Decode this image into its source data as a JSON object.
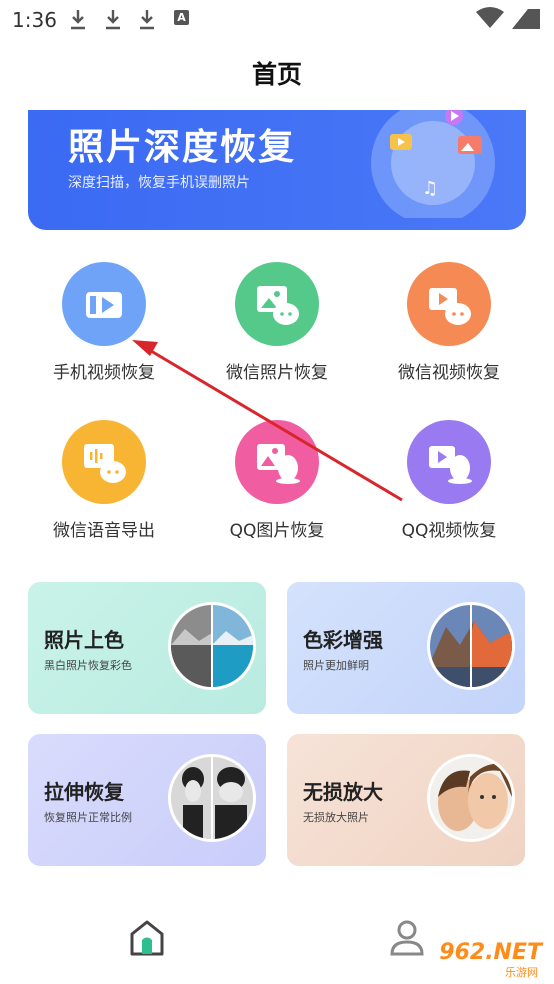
{
  "status_bar": {
    "time": "1:36",
    "icons": [
      "download-icon",
      "download-icon",
      "download-icon",
      "a-icon",
      "wifi-icon",
      "battery-icon"
    ],
    "a_label": "A"
  },
  "header": {
    "title": "首页"
  },
  "banner": {
    "title": "照片深度恢复",
    "subtitle": "深度扫描，恢复手机误删照片"
  },
  "features": [
    {
      "label": "手机视频恢复",
      "icon": "video-icon",
      "color": "#6fa3f7"
    },
    {
      "label": "微信照片恢复",
      "icon": "wechat-photo-icon",
      "color": "#55c98a"
    },
    {
      "label": "微信视频恢复",
      "icon": "wechat-video-icon",
      "color": "#f58a55"
    },
    {
      "label": "微信语音导出",
      "icon": "wechat-voice-icon",
      "color": "#f8b534"
    },
    {
      "label": "QQ图片恢复",
      "icon": "qq-photo-icon",
      "color": "#f05ea1"
    },
    {
      "label": "QQ视频恢复",
      "icon": "qq-video-icon",
      "color": "#9a7af0"
    }
  ],
  "cards": [
    {
      "title": "照片上色",
      "subtitle": "黑白照片恢复彩色",
      "bg": "#c5f0e6"
    },
    {
      "title": "色彩增强",
      "subtitle": "照片更加鲜明",
      "bg": "#cfdcfb"
    },
    {
      "title": "拉伸恢复",
      "subtitle": "恢复照片正常比例",
      "bg": "#d4d8fb"
    },
    {
      "title": "无损放大",
      "subtitle": "无损放大照片",
      "bg": "#f4ddd0"
    }
  ],
  "bottom_nav": {
    "items": [
      "home-icon",
      "user-icon"
    ]
  },
  "watermark": {
    "text": "962.NET",
    "sub": "乐游网"
  }
}
